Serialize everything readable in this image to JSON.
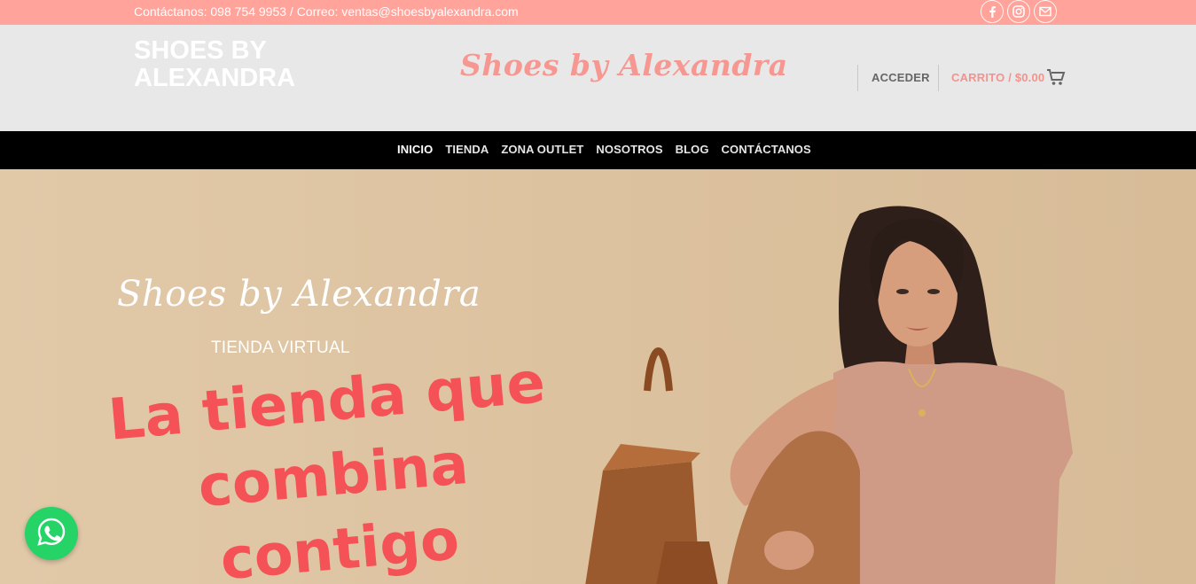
{
  "topbar": {
    "contact": "Contáctanos: 098 754 9953 / Correo: ventas@shoesbyalexandra.com",
    "social": [
      "facebook-icon",
      "instagram-icon",
      "envelope-icon"
    ]
  },
  "header": {
    "brand_text": "SHOES BY ALEXANDRA",
    "brand_script": "Shoes by Alexandra",
    "login": "ACCEDER",
    "cart": "CARRITO / $0.00"
  },
  "nav": {
    "items": [
      "INICIO",
      "TIENDA",
      "ZONA OUTLET",
      "NOSOTROS",
      "BLOG",
      "CONTÁCTANOS"
    ],
    "active": "INICIO"
  },
  "hero": {
    "script_title": "Shoes by Alexandra",
    "subtitle": "TIENDA VIRTUAL",
    "headline": "La tienda que combina contigo"
  },
  "colors": {
    "topbar": "#ffa39b",
    "header_bg": "#e8e8e9",
    "accent": "#f69791",
    "nav_bg": "#000000",
    "headline": "#f45257",
    "whatsapp": "#25d366"
  }
}
